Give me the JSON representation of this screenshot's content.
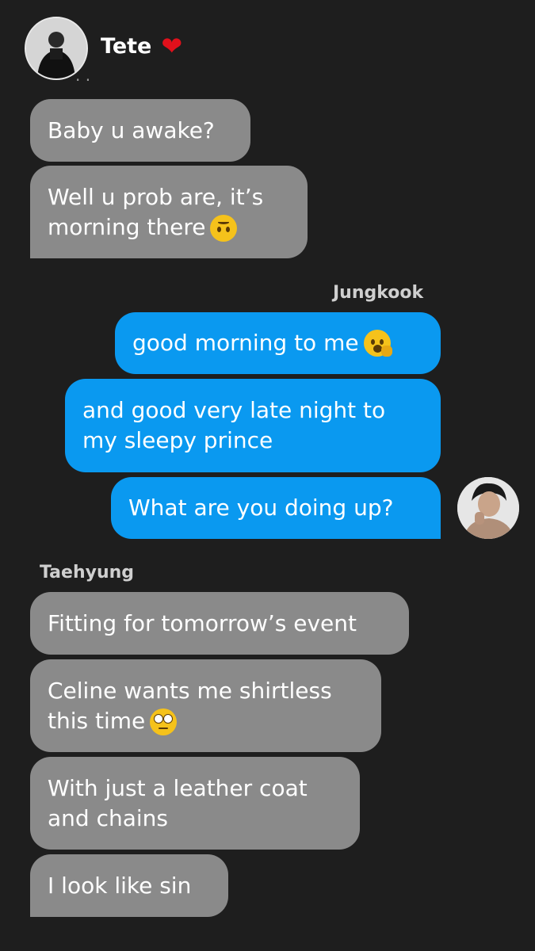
{
  "header": {
    "contact_name": "Tete",
    "heart_icon": "❤",
    "clipped_text": "· ·"
  },
  "messages": [
    {
      "sender": "Taehyung",
      "side": "in",
      "text": "Baby u awake?"
    },
    {
      "sender": "Taehyung",
      "side": "in",
      "line1": "Well u prob are, it’s",
      "line2": "morning there",
      "emoji": "upside-down-face-emoji"
    },
    {
      "sender_label": "Jungkook"
    },
    {
      "sender": "Jungkook",
      "side": "out",
      "text": "good morning to me",
      "emoji": "yawning-face-emoji"
    },
    {
      "sender": "Jungkook",
      "side": "out",
      "line1": "and good very late night to",
      "line2": "my sleepy prince"
    },
    {
      "sender": "Jungkook",
      "side": "out",
      "text": "What are you doing up?"
    },
    {
      "sender_label": "Taehyung"
    },
    {
      "sender": "Taehyung",
      "side": "in",
      "text": "Fitting for tomorrow’s event"
    },
    {
      "sender": "Taehyung",
      "side": "in",
      "line1": "Celine wants me shirtless",
      "line2": "this time",
      "emoji": "face-with-rolling-eyes-emoji"
    },
    {
      "sender": "Taehyung",
      "side": "in",
      "line1": "With just a leather coat",
      "line2": "and chains"
    },
    {
      "sender": "Taehyung",
      "side": "in",
      "text": "I look like sin"
    }
  ],
  "colors": {
    "background": "#1e1e1e",
    "incoming_bubble": "#8a8a8a",
    "outgoing_bubble": "#0a99f0",
    "heart": "#e0101b"
  }
}
